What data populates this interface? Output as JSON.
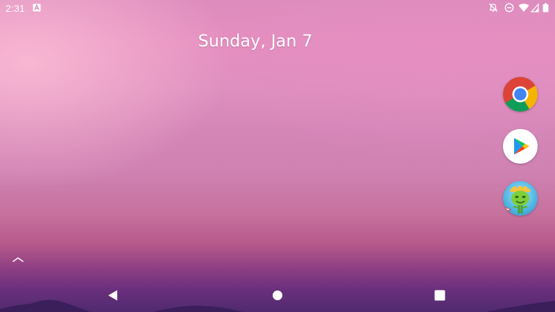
{
  "status_bar": {
    "time": "2:31",
    "notification_icon": "a-letter-notification-icon",
    "icons": [
      "notifications-off-icon",
      "do-not-disturb-icon",
      "wifi-icon",
      "cellular-signal-icon",
      "battery-icon"
    ]
  },
  "home": {
    "date": "Sunday, Jan 7"
  },
  "apps": [
    {
      "name": "Chrome",
      "icon": "chrome-icon"
    },
    {
      "name": "Play Store",
      "icon": "play-store-icon"
    },
    {
      "name": "Game",
      "icon": "game-character-icon"
    }
  ],
  "navigation": {
    "buttons": [
      "back",
      "home",
      "recents"
    ]
  },
  "colors": {
    "wallpaper_top": "#dd8cbd",
    "wallpaper_highlight": "#fcbed6",
    "wallpaper_bottom": "#4f2a6f",
    "text": "#ffffff",
    "chrome_red": "#db4437",
    "chrome_yellow": "#f4b400",
    "chrome_green": "#0f9d58",
    "chrome_blue": "#4285f4"
  }
}
